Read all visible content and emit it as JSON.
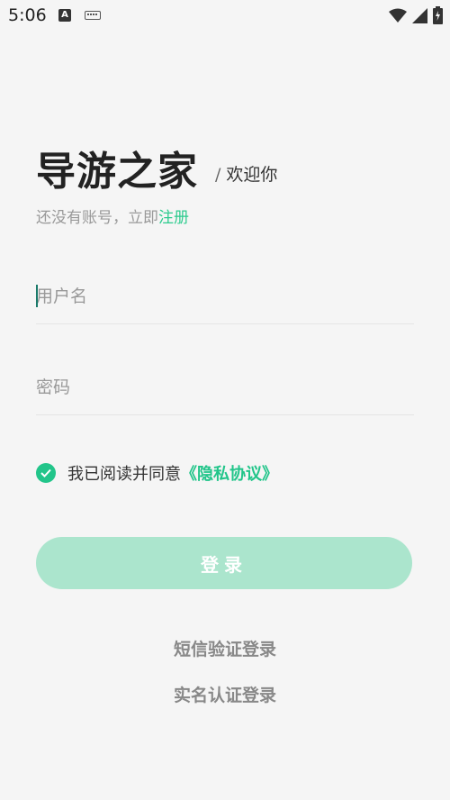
{
  "status_bar": {
    "time": "5:06",
    "icons": [
      "a-notification-icon",
      "keyboard-icon",
      "wifi-icon",
      "signal-icon",
      "battery-icon"
    ]
  },
  "header": {
    "app_title": "导游之家",
    "slash": "/",
    "welcome": "欢迎你"
  },
  "register": {
    "prompt": "还没有账号，立即",
    "link": "注册"
  },
  "form": {
    "username_placeholder": "用户名",
    "username_value": "",
    "password_placeholder": "密码",
    "password_value": ""
  },
  "agreement": {
    "checked": true,
    "text": "我已阅读并同意",
    "link": "《隐私协议》"
  },
  "buttons": {
    "login": "登录",
    "sms_login": "短信验证登录",
    "realname_login": "实名认证登录"
  },
  "colors": {
    "accent": "#22c58a",
    "button_bg": "#abe5cd",
    "background": "#f5f5f5"
  }
}
